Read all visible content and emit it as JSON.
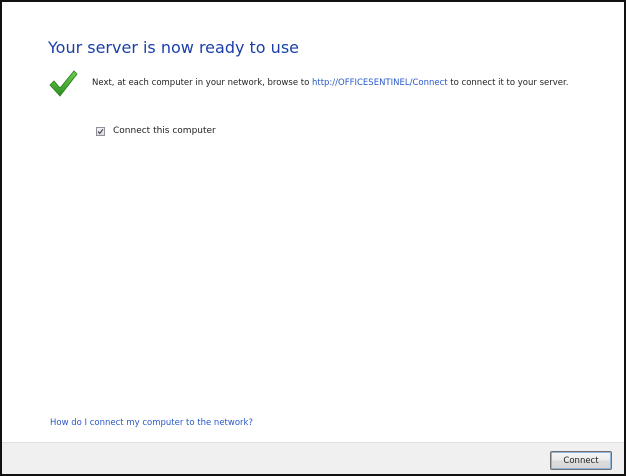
{
  "dialog": {
    "title": "Your server is now ready to use",
    "message_prefix": "Next, at each computer in your network, browse to ",
    "connect_url": "http://OFFICESENTINEL/Connect",
    "message_suffix": " to connect it to your server.",
    "checkbox_label": "Connect this computer",
    "checkbox_checked": true,
    "help_link": "How do I connect my computer to the network?"
  },
  "footer": {
    "connect_button_label": "Connect"
  },
  "icons": {
    "status": "checkmark-icon",
    "checkmark_color": "#3aa52a"
  },
  "colors": {
    "title": "#1a3fa8",
    "link": "#2a58c8",
    "footer_background": "#f0f0f0"
  }
}
